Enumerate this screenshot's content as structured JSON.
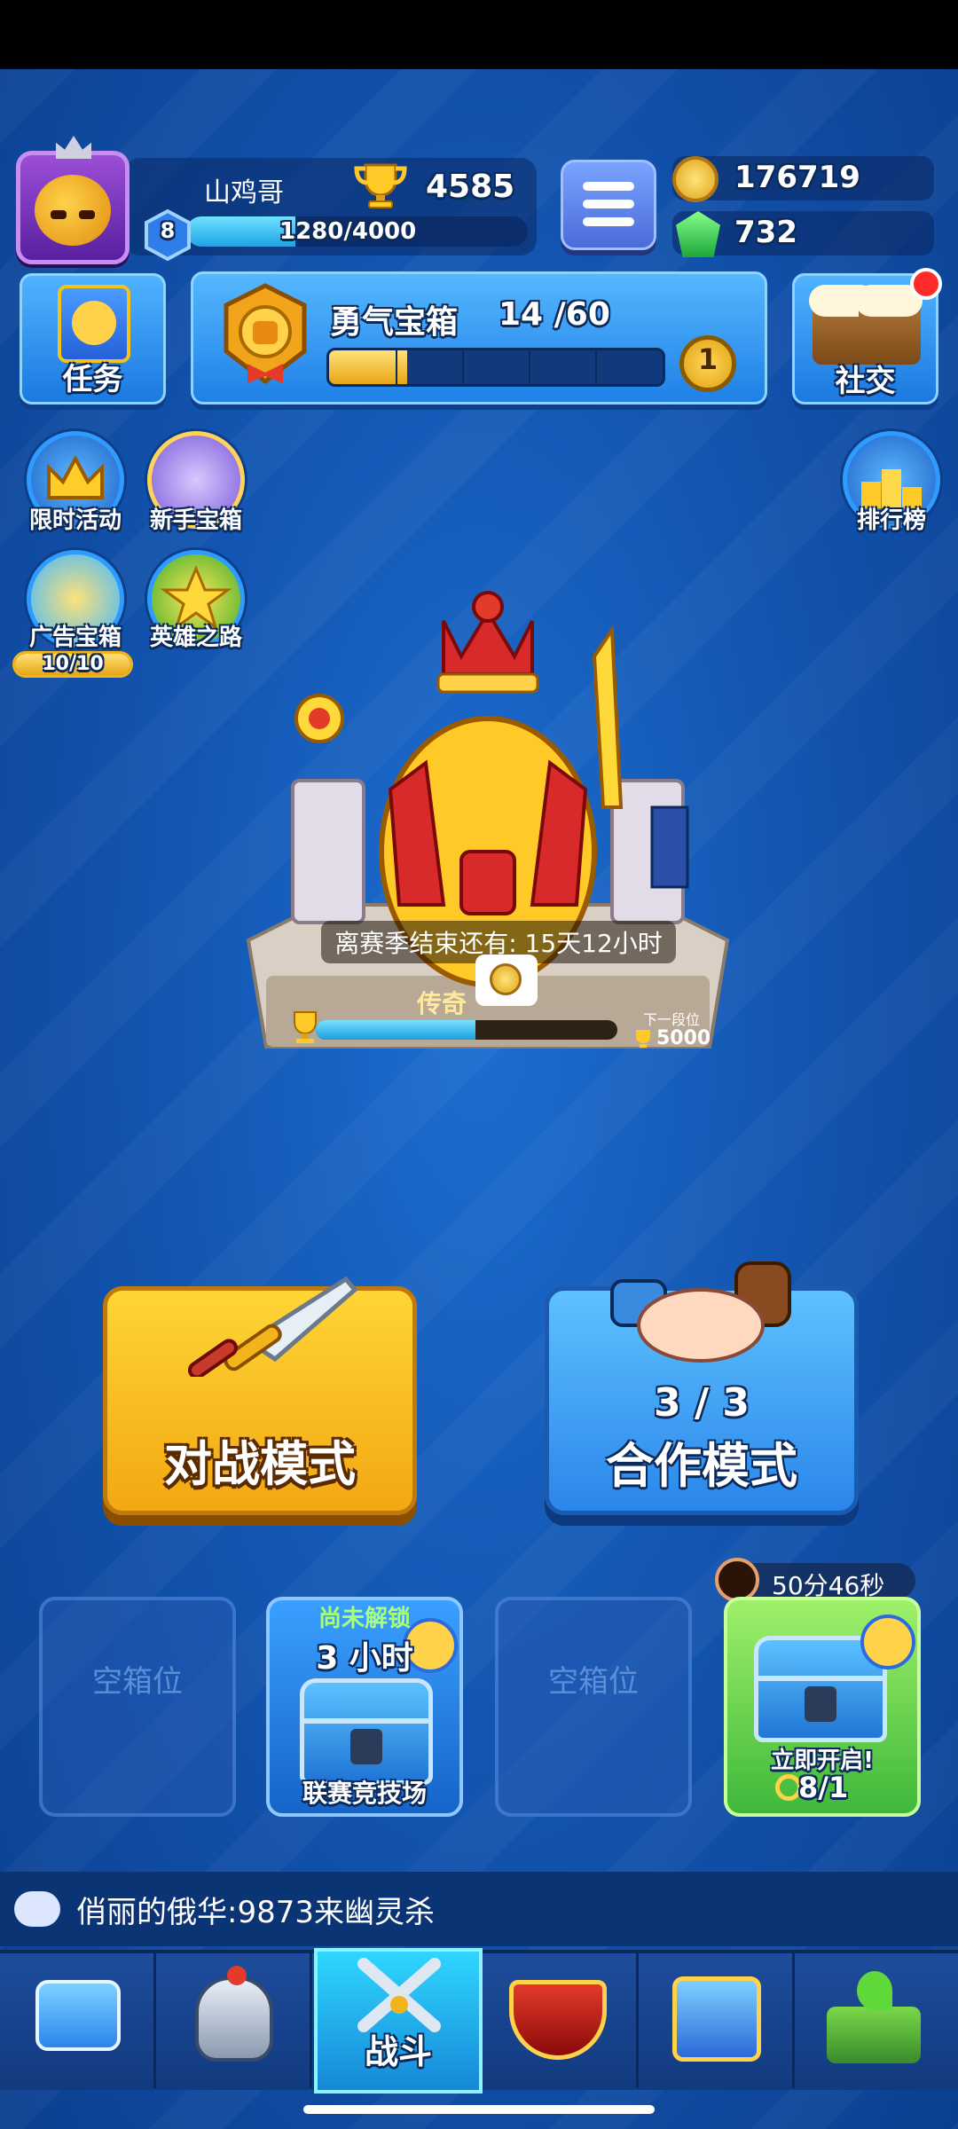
{
  "profile": {
    "name": "山鸡哥",
    "trophies": "4585",
    "level": "8",
    "xp_text": "1280/4000",
    "xp_progress": 0.32
  },
  "currency": {
    "coins": "176719",
    "gems": "732"
  },
  "tasks": {
    "label": "任务"
  },
  "courage_chest": {
    "title": "勇气宝箱",
    "progress_text": "14 /60",
    "progress": 0.2333,
    "keys": "1"
  },
  "social": {
    "label": "社交"
  },
  "side_left": [
    {
      "label": "限时活动",
      "icon": "crown-event-icon"
    },
    {
      "label": "新手宝箱",
      "icon": "beginner-chest-icon"
    },
    {
      "label": "广告宝箱",
      "icon": "ad-chest-icon",
      "counter": "10/10"
    },
    {
      "label": "英雄之路",
      "icon": "hero-path-icon"
    }
  ],
  "ranking": {
    "label": "排行榜"
  },
  "season": {
    "remaining_text": "离赛季结束还有: 15天12小时",
    "rank_name": "传奇",
    "progress": 0.53,
    "next_label": "下一段位",
    "next_value": "5000"
  },
  "modes": {
    "battle": {
      "label": "对战模式"
    },
    "coop": {
      "label": "合作模式",
      "count": "3 / 3"
    }
  },
  "slots": {
    "empty_label": "空箱位",
    "locked": {
      "title": "尚未解锁",
      "time": "3 小时",
      "name": "联赛竞技场"
    },
    "ready": {
      "timer": "50分46秒",
      "open_label": "立即开启!",
      "keys": "8/1"
    }
  },
  "chat": {
    "message": "俏丽的俄华:9873来幽灵杀"
  },
  "nav": {
    "active_label": "战斗",
    "items": [
      "shop-icon",
      "heroes-icon",
      "battle-icon",
      "clan-icon",
      "social-cards-icon",
      "garden-icon"
    ]
  },
  "colors": {
    "bg": "#1356b2",
    "battle": "#ffd535",
    "coop": "#2a86ea",
    "active_tab": "#2fd6ff"
  }
}
